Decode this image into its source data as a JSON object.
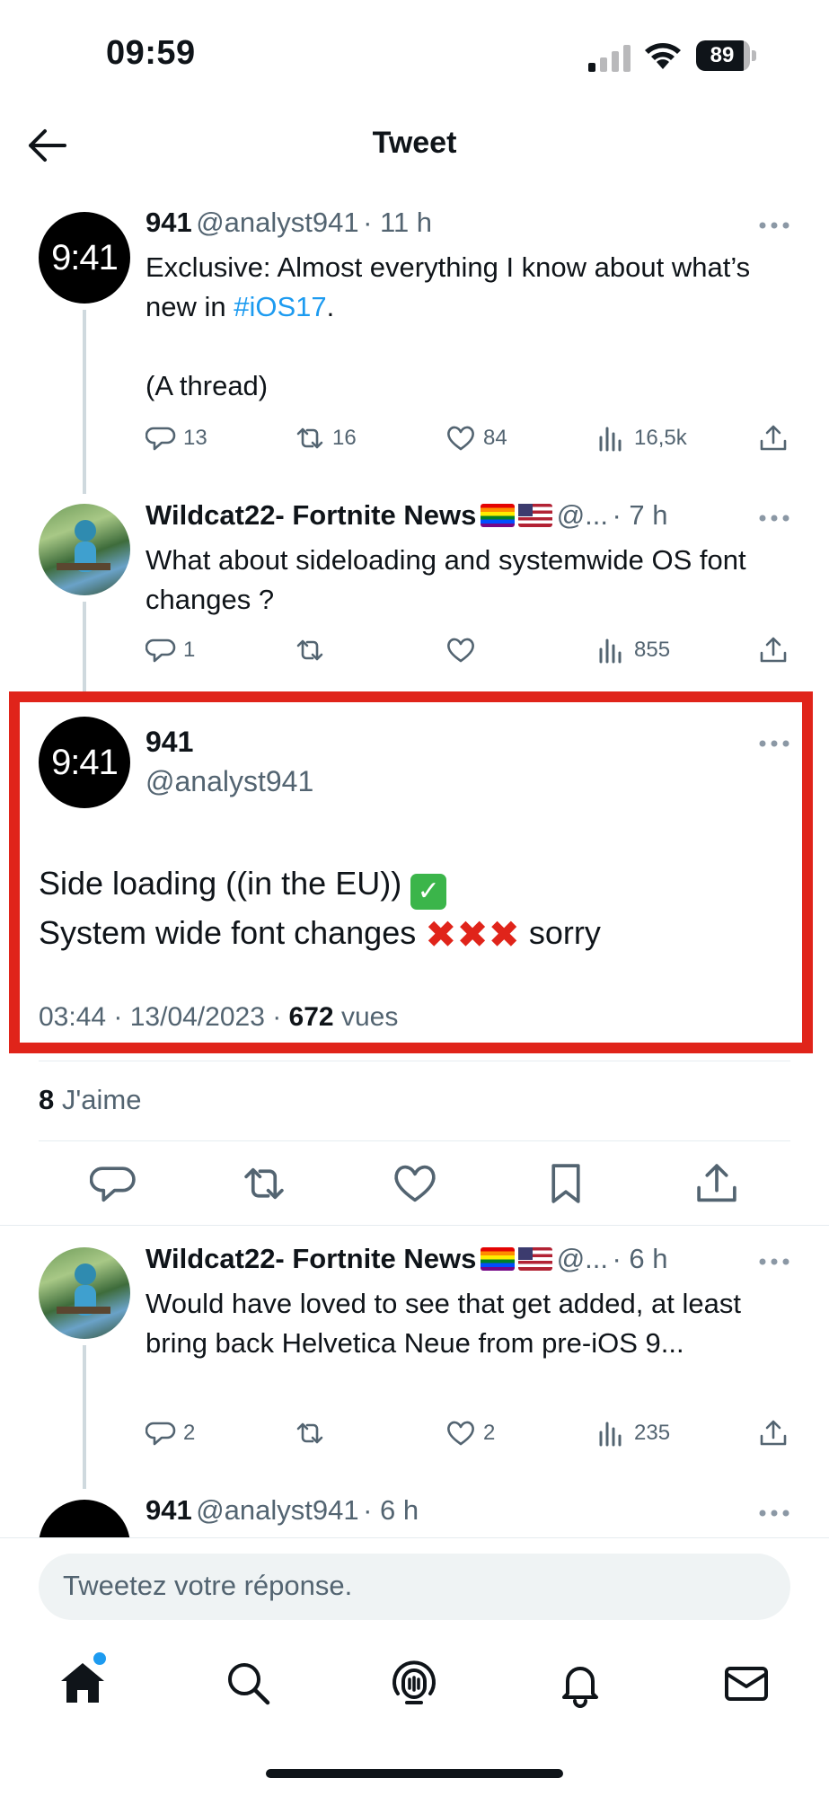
{
  "status_bar": {
    "time": "09:59",
    "battery": "89",
    "battery_level": 0.89
  },
  "header": {
    "title": "Tweet"
  },
  "thread": [
    {
      "name": "941",
      "handle": "@analyst941",
      "time": "· 11 h",
      "avatar_text": "9:41",
      "text_before": "Exclusive: Almost everything I know about what’s new in ",
      "hashtag": "#iOS17",
      "text_after": ".",
      "text2": "(A thread)",
      "replies": "13",
      "retweets": "16",
      "likes": "84",
      "views": "16,5k"
    },
    {
      "name": "Wildcat22- Fortnite News",
      "handle": "@...",
      "time": "· 7 h",
      "text": "What about sideloading and systemwide OS font changes ?",
      "replies": "1",
      "retweets": "",
      "likes": "",
      "views": "855"
    }
  ],
  "main_tweet": {
    "avatar_text": "9:41",
    "name": "941",
    "handle": "@analyst941",
    "line1": "Side loading ((in the EU))",
    "line2": "System wide font changes",
    "line2_end": "sorry",
    "cross": "✖",
    "check": "✓",
    "timestamp": "03:44 · 13/04/2023 · ",
    "views_count": "672",
    "views_label": " vues",
    "likes_count": "8",
    "likes_label": " J'aime"
  },
  "replies": [
    {
      "name": "Wildcat22- Fortnite News",
      "handle": "@...",
      "time": "· 6 h",
      "text": "Would have loved to see that get added, at least bring back Helvetica Neue from pre-iOS 9...",
      "replies": "2",
      "retweets": "",
      "likes": "2",
      "views": "235"
    },
    {
      "name": "941",
      "handle": "@analyst941",
      "time": "· 6 h"
    }
  ],
  "reply_input": {
    "placeholder": "Tweetez votre réponse."
  },
  "bottom_nav": [
    "home-icon",
    "search-icon",
    "spaces-icon",
    "notifications-icon",
    "messages-icon"
  ]
}
